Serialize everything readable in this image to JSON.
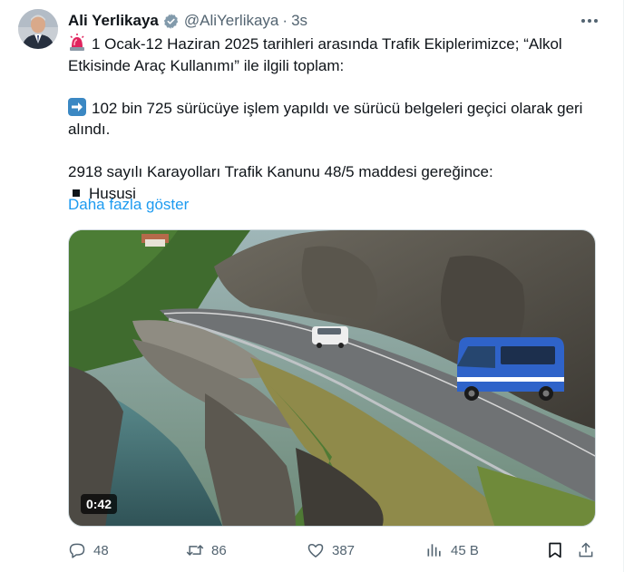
{
  "author": {
    "name": "Ali Yerlikaya",
    "handle": "@AliYerlikaya",
    "separator": "·",
    "time": "3s"
  },
  "tweet": {
    "line1": "1 Ocak-12 Haziran 2025 tarihleri arasında Trafik Ekiplerimizce; “Alkol",
    "line2": "Etkisinde Araç Kullanımı” ile ilgili toplam:",
    "line3": "102 bin 725 sürücüye işlem yapıldı ve sürücü belgeleri geçici olarak geri",
    "line4": "alındı.",
    "line5": "2918 sayılı Karayolları Trafik Kanunu 48/5 maddesi gereğince:",
    "line6": "Hususi",
    "show_more": "Daha fazla göster"
  },
  "media": {
    "duration": "0:42"
  },
  "actions": {
    "replies": "48",
    "reposts": "86",
    "likes": "387",
    "views": "45 B"
  },
  "icons": {
    "siren": "police-light-emoji",
    "arrow": "right-arrow-emoji",
    "verified": "verified-badge-icon",
    "more": "more-dots-icon",
    "reply": "reply-icon",
    "repost": "repost-icon",
    "like": "heart-icon",
    "views": "views-icon",
    "bookmark": "bookmark-icon",
    "share": "share-icon"
  },
  "colors": {
    "accent": "#1d9bf0",
    "muted": "#536471",
    "text": "#0f1419"
  }
}
